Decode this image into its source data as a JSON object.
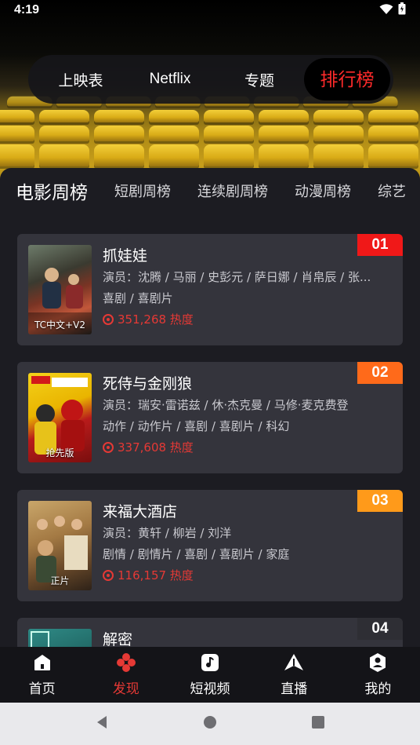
{
  "status_bar": {
    "time": "4:19"
  },
  "top_tabs": [
    {
      "label": "上映表",
      "active": false
    },
    {
      "label": "Netflix",
      "active": false
    },
    {
      "label": "专题",
      "active": false
    },
    {
      "label": "排行榜",
      "active": true
    }
  ],
  "category_tabs": [
    {
      "label": "电影周榜",
      "active": true
    },
    {
      "label": "短剧周榜",
      "active": false
    },
    {
      "label": "连续剧周榜",
      "active": false
    },
    {
      "label": "动漫周榜",
      "active": false
    },
    {
      "label": "综艺",
      "active": false
    }
  ],
  "movies": [
    {
      "rank": "01",
      "rank_color": "#f01818",
      "title": "抓娃娃",
      "cast": "演员：沈腾 / 马丽 / 史彭元 / 萨日娜 / 肖帛辰 / 张...",
      "genres": "喜剧 / 喜剧片",
      "heat": "351,268 热度",
      "poster_caption": "TC中文+V2"
    },
    {
      "rank": "02",
      "rank_color": "#ff6a1a",
      "title": "死侍与金刚狼",
      "cast": "演员：瑞安·雷诺兹 / 休·杰克曼 / 马修·麦克费登",
      "genres": "动作 / 动作片 / 喜剧 / 喜剧片 / 科幻",
      "heat": "337,608 热度",
      "poster_caption": "抢先版"
    },
    {
      "rank": "03",
      "rank_color": "#ff9a1a",
      "title": "来福大酒店",
      "cast": "演员：黄轩  /  柳岩 / 刘洋",
      "genres": "剧情 / 剧情片 / 喜剧 / 喜剧片 / 家庭",
      "heat": "116,157 热度",
      "poster_caption": "正片"
    },
    {
      "rank": "04",
      "rank_color": "#2e2e34",
      "title": "解密",
      "cast": "",
      "genres": "",
      "heat": "",
      "poster_caption": ""
    }
  ],
  "bottom_nav": [
    {
      "label": "首页",
      "icon": "home-icon",
      "active": false
    },
    {
      "label": "发现",
      "icon": "discover-icon",
      "active": true
    },
    {
      "label": "短视频",
      "icon": "music-note-icon",
      "active": false
    },
    {
      "label": "直播",
      "icon": "live-icon",
      "active": false
    },
    {
      "label": "我的",
      "icon": "profile-icon",
      "active": false
    }
  ],
  "colors": {
    "accent": "#e53935",
    "panel": "#1c1c22",
    "card": "#34343c"
  }
}
